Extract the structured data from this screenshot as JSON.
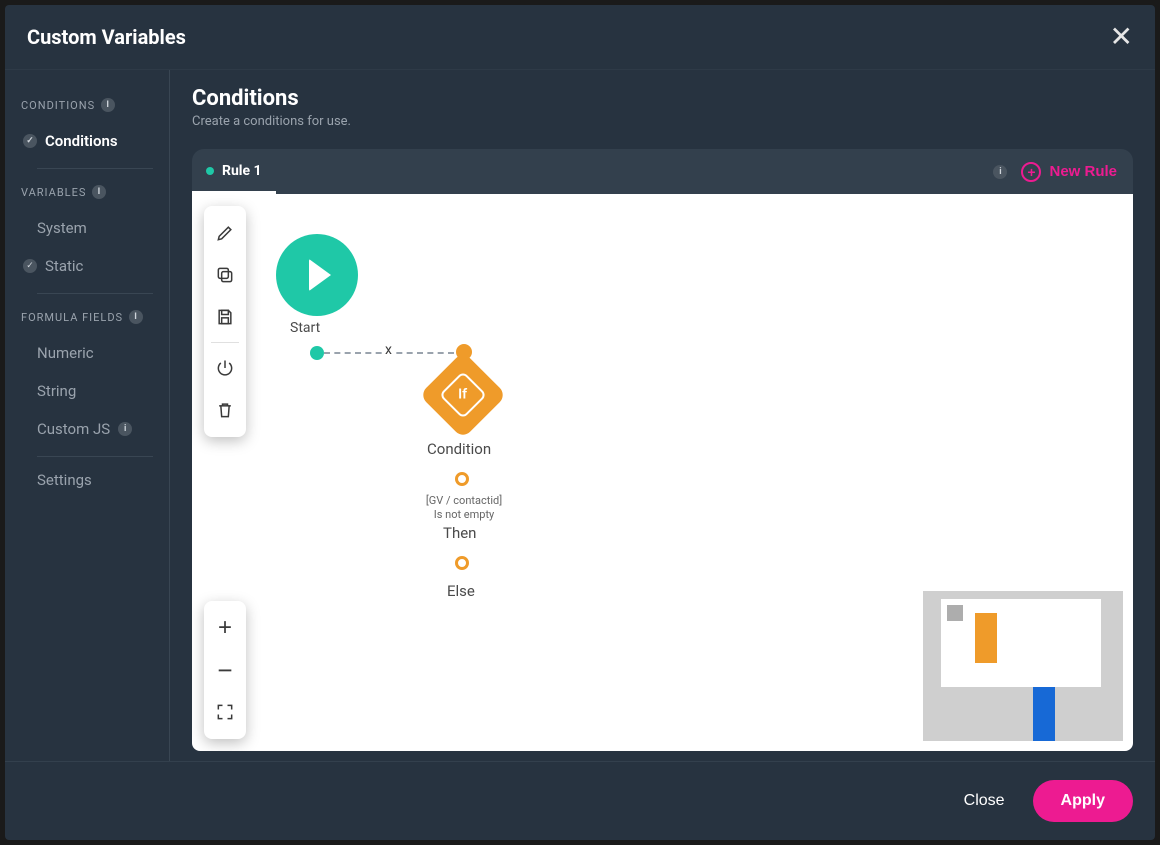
{
  "modal": {
    "title": "Custom Variables"
  },
  "sidebar": {
    "sections": [
      {
        "title": "CONDITIONS",
        "items": [
          {
            "label": "Conditions",
            "active": true,
            "checked": true
          }
        ]
      },
      {
        "title": "VARIABLES",
        "items": [
          {
            "label": "System",
            "active": false,
            "checked": false
          },
          {
            "label": "Static",
            "active": false,
            "checked": true
          }
        ]
      },
      {
        "title": "FORMULA FIELDS",
        "items": [
          {
            "label": "Numeric"
          },
          {
            "label": "String"
          },
          {
            "label": "Custom JS",
            "infoBadge": true
          }
        ]
      }
    ],
    "bottomItem": {
      "label": "Settings"
    }
  },
  "main": {
    "title": "Conditions",
    "subtitle": "Create a conditions for use.",
    "tabs": [
      {
        "label": "Rule 1",
        "active": true
      }
    ],
    "newRuleLabel": "New Rule"
  },
  "toolbar": {
    "editTool": "edit",
    "copyTool": "copy",
    "saveTool": "save",
    "powerTool": "power",
    "deleteTool": "delete",
    "zoomIn": "+",
    "zoomOut": "−",
    "fit": "fit"
  },
  "flow": {
    "startLabel": "Start",
    "conditionNodeText": "If",
    "conditionLabel": "Condition",
    "linkDeleteLabel": "x",
    "expressionLine1": "[GV / contactid]",
    "expressionLine2": "Is not empty",
    "thenLabel": "Then",
    "elseLabel": "Else"
  },
  "footer": {
    "close": "Close",
    "apply": "Apply"
  },
  "colors": {
    "accentPink": "#ed1b91",
    "accentTeal": "#1fc8a7",
    "accentOrange": "#ef9b2a",
    "bgDark": "#273340"
  }
}
